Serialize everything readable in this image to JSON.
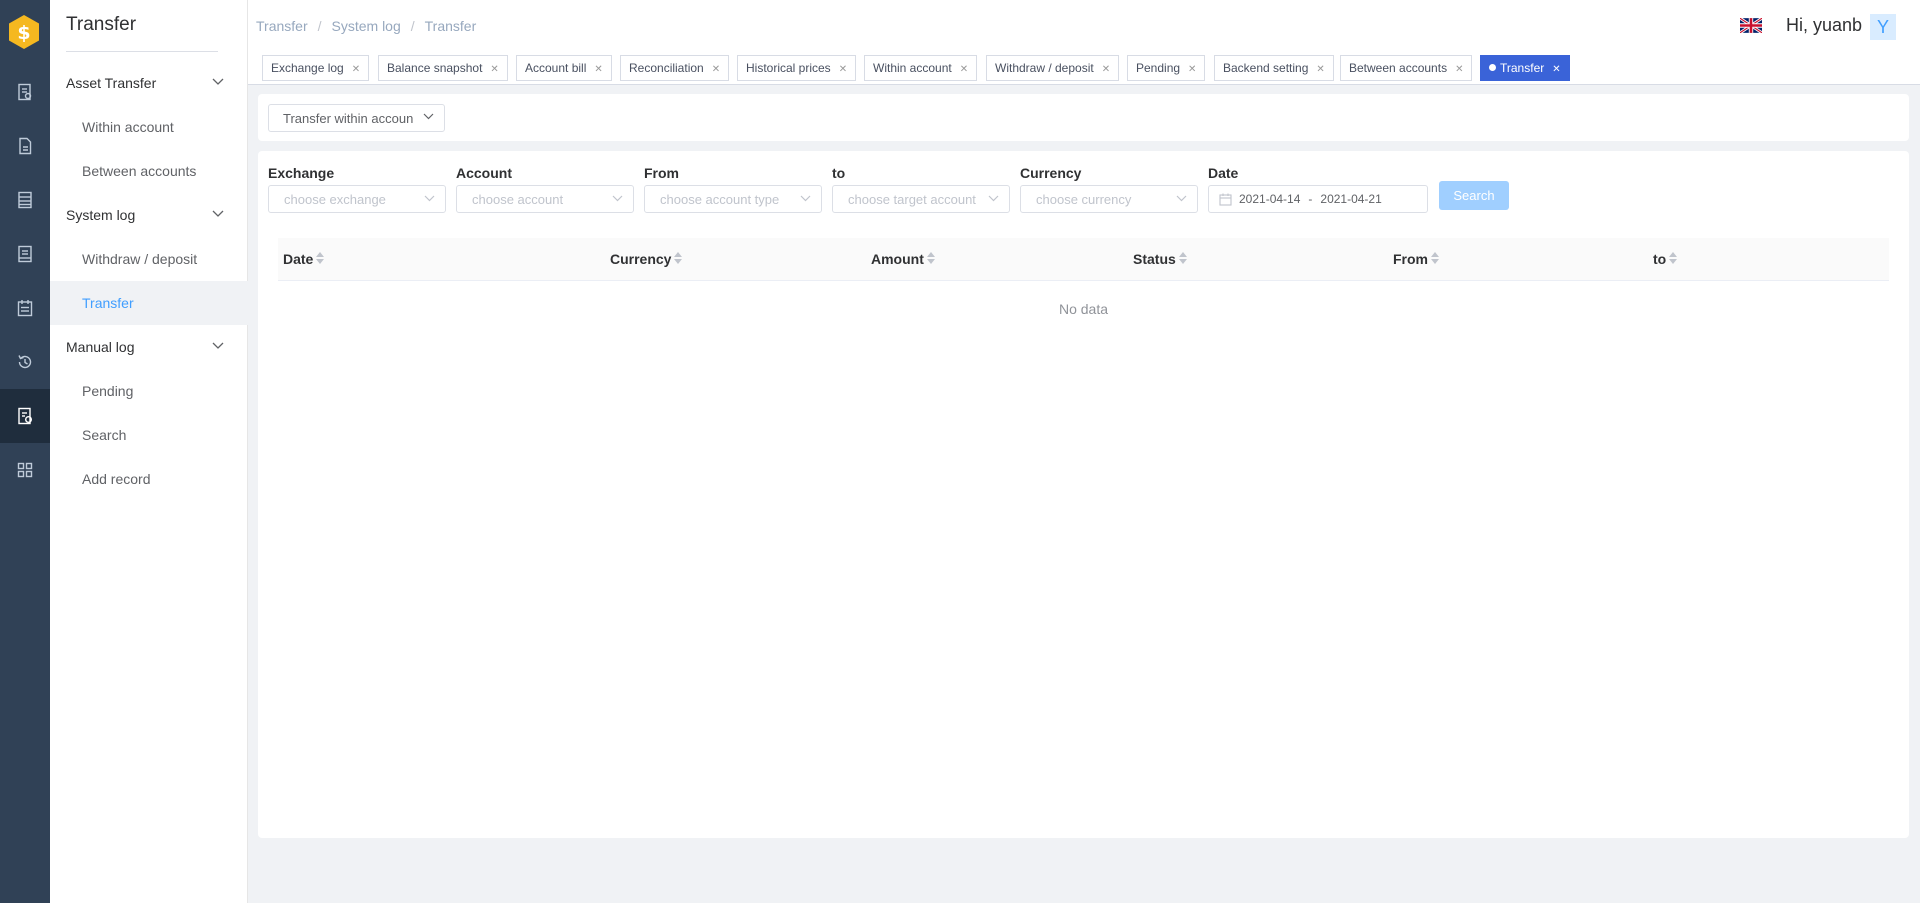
{
  "colors": {
    "rail": "#304156",
    "accent": "#409eff",
    "active_tab": "#3a63d8",
    "search_button": "#a0cfff",
    "logo": "#f5b820"
  },
  "rail_icons": [
    "logo-icon",
    "report-icon",
    "document-icon",
    "list-icon",
    "ledger-icon",
    "calendar-icon",
    "history-icon",
    "transfer-log-icon",
    "grid-icon"
  ],
  "sidebar": {
    "title": "Transfer",
    "groups": [
      {
        "label": "Asset Transfer",
        "items": [
          "Within account",
          "Between accounts"
        ]
      },
      {
        "label": "System log",
        "items": [
          "Withdraw / deposit",
          "Transfer"
        ]
      },
      {
        "label": "Manual log",
        "items": [
          "Pending",
          "Search",
          "Add record"
        ]
      }
    ],
    "active_item": "Transfer"
  },
  "header": {
    "breadcrumb": [
      "Transfer",
      "System log",
      "Transfer"
    ],
    "language_icon": "uk-flag-icon",
    "greeting": "Hi, yuanb",
    "avatar_letter": "Y"
  },
  "tabs": [
    {
      "label": "Exchange log",
      "active": false
    },
    {
      "label": "Balance snapshot",
      "active": false
    },
    {
      "label": "Account bill",
      "active": false
    },
    {
      "label": "Reconciliation",
      "active": false
    },
    {
      "label": "Historical prices",
      "active": false
    },
    {
      "label": "Within account",
      "active": false
    },
    {
      "label": "Withdraw / deposit",
      "active": false
    },
    {
      "label": "Pending",
      "active": false
    },
    {
      "label": "Backend setting",
      "active": false
    },
    {
      "label": "Between accounts",
      "active": false
    },
    {
      "label": "Transfer",
      "active": true
    }
  ],
  "type_select": {
    "value": "Transfer within accoun"
  },
  "filters": {
    "exchange": {
      "label": "Exchange",
      "placeholder": "choose exchange"
    },
    "account": {
      "label": "Account",
      "placeholder": "choose account"
    },
    "from": {
      "label": "From",
      "placeholder": "choose account type"
    },
    "to": {
      "label": "to",
      "placeholder": "choose target account"
    },
    "currency": {
      "label": "Currency",
      "placeholder": "choose currency"
    },
    "date": {
      "label": "Date",
      "start": "2021-04-14",
      "separator": "-",
      "end": "2021-04-21"
    },
    "search_label": "Search"
  },
  "table": {
    "columns": [
      "Date",
      "Currency",
      "Amount",
      "Status",
      "From",
      "to"
    ],
    "empty_text": "No data"
  }
}
